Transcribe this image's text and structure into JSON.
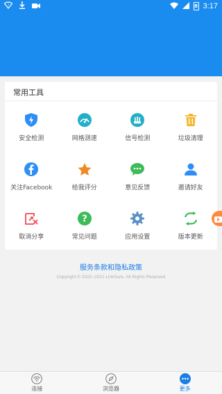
{
  "status_bar": {
    "time": "3:17",
    "battery_level": "8"
  },
  "tools_card": {
    "title": "常用工具",
    "items": [
      {
        "label": "安全检测",
        "icon": "shield-lightning-icon",
        "color": "#2f8ef5"
      },
      {
        "label": "网格测速",
        "icon": "speedometer-icon",
        "color": "#22b0c8"
      },
      {
        "label": "信号检测",
        "icon": "signal-meter-icon",
        "color": "#22b0c8"
      },
      {
        "label": "垃圾清理",
        "icon": "trash-icon",
        "color": "#f5b731"
      },
      {
        "label": "关注Facebook",
        "icon": "facebook-icon",
        "color": "#2f8ef5"
      },
      {
        "label": "给我评分",
        "icon": "star-icon",
        "color": "#f08a24"
      },
      {
        "label": "意见反馈",
        "icon": "chat-bubble-icon",
        "color": "#3dbb5a"
      },
      {
        "label": "邀请好友",
        "icon": "person-icon",
        "color": "#2f8ef5"
      },
      {
        "label": "取消分享",
        "icon": "cancel-share-icon",
        "color": "#f0484f"
      },
      {
        "label": "常见问题",
        "icon": "question-icon",
        "color": "#3dbb5a"
      },
      {
        "label": "应用设置",
        "icon": "gear-icon",
        "color": "#5a8fc8"
      },
      {
        "label": "版本更新",
        "icon": "refresh-arrows-icon",
        "color": "#3dbb5a"
      }
    ]
  },
  "footer": {
    "terms_link": "服务条款和隐私政策",
    "copyright": "Copyright © 2015~2021 LinkSure. All Rights Reserved"
  },
  "bottom_nav": {
    "items": [
      {
        "label": "连接",
        "icon": "wifi-icon",
        "active": false
      },
      {
        "label": "浏览器",
        "icon": "compass-icon",
        "active": false
      },
      {
        "label": "更多",
        "icon": "more-dots-icon",
        "active": true
      }
    ]
  },
  "colors": {
    "primary": "#1a8cf0",
    "link": "#1a7ee6",
    "background": "#f2f2f2"
  }
}
